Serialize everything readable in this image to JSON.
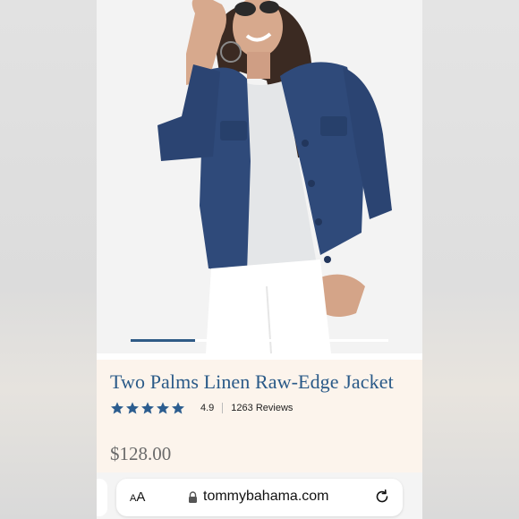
{
  "product": {
    "title": "Two Palms Linen Raw-Edge Jacket",
    "rating": "4.9",
    "rating_fraction": 0.98,
    "reviews": "1263 Reviews",
    "price": "$128.00"
  },
  "carousel": {
    "active_index": 0,
    "count": 4
  },
  "browser": {
    "text_size_label": "AA",
    "url": "tommybahama.com"
  },
  "icons": {
    "star": "star-icon",
    "lock": "lock-icon",
    "reload": "reload-icon"
  },
  "colors": {
    "title": "#2a5a88",
    "star": "#2c5d8f",
    "jacket": "#2f4a7a",
    "info_bg": "#fcf4ec",
    "carousel_active": "#2f5b86"
  }
}
